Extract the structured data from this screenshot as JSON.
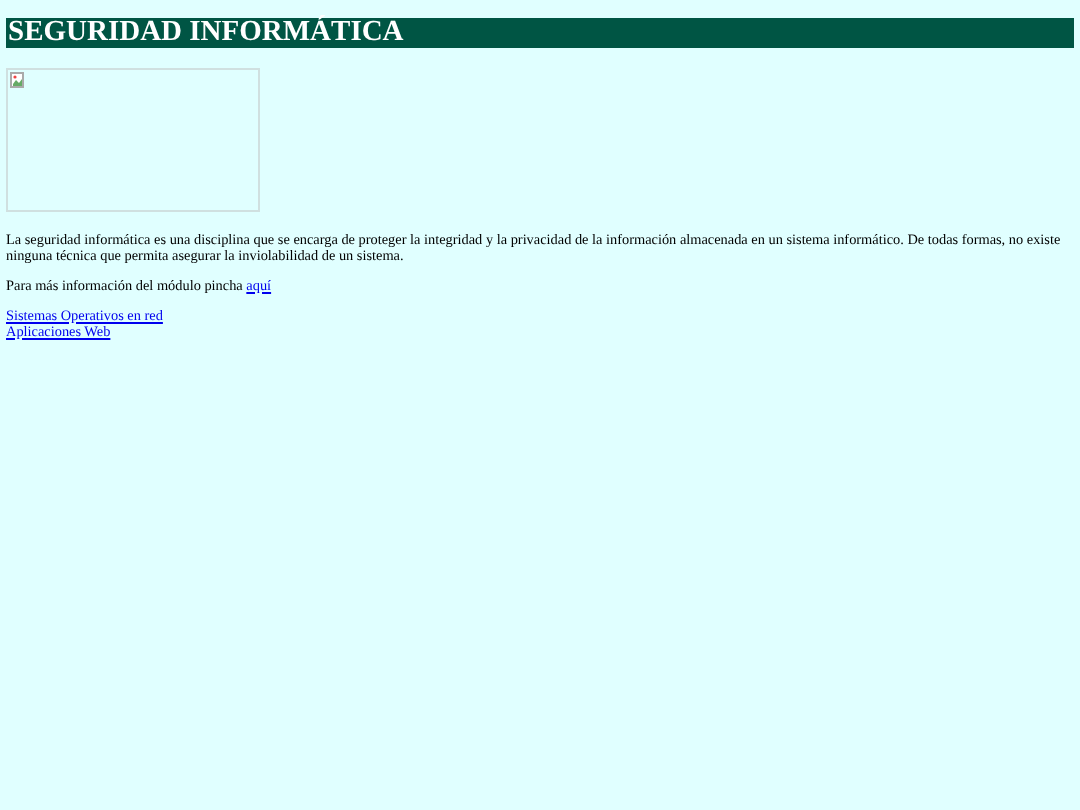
{
  "heading": "SEGURIDAD INFORMÁTICA",
  "image": {
    "kind": "broken-image"
  },
  "intro": "La seguridad informática es una disciplina que se encarga de proteger la integridad y la privacidad de la información almacenada en un sistema informático. De todas formas, no existe ninguna técnica que permita asegurar la inviolabilidad de un sistema.",
  "more_info": {
    "text": "Para más información del módulo pincha",
    "link": "aquí"
  },
  "links": [
    "Sistemas Operativos en red",
    "Aplicaciones Web"
  ]
}
